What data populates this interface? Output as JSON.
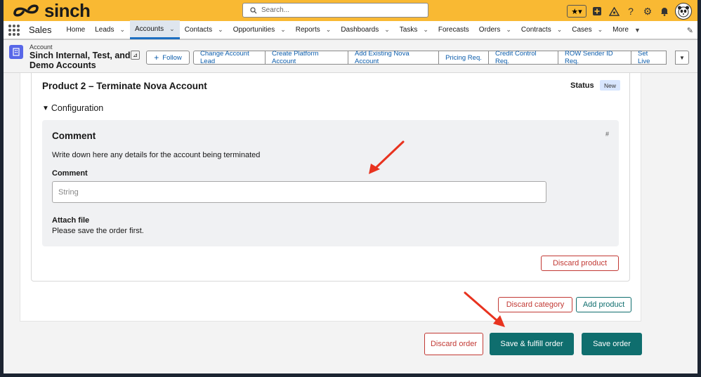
{
  "brand": {
    "name": "sinch"
  },
  "search": {
    "placeholder": "Search..."
  },
  "nav": {
    "app_name": "Sales",
    "items": [
      {
        "label": "Home",
        "has_menu": false,
        "active": false
      },
      {
        "label": "Leads",
        "has_menu": true,
        "active": false
      },
      {
        "label": "Accounts",
        "has_menu": true,
        "active": true
      },
      {
        "label": "Contacts",
        "has_menu": true,
        "active": false
      },
      {
        "label": "Opportunities",
        "has_menu": true,
        "active": false
      },
      {
        "label": "Reports",
        "has_menu": true,
        "active": false
      },
      {
        "label": "Dashboards",
        "has_menu": true,
        "active": false
      },
      {
        "label": "Tasks",
        "has_menu": true,
        "active": false
      },
      {
        "label": "Forecasts",
        "has_menu": false,
        "active": false
      },
      {
        "label": "Orders",
        "has_menu": true,
        "active": false
      },
      {
        "label": "Contracts",
        "has_menu": true,
        "active": false
      },
      {
        "label": "Cases",
        "has_menu": true,
        "active": false
      },
      {
        "label": "More",
        "has_menu": true,
        "active": false
      }
    ]
  },
  "record": {
    "type": "Account",
    "name": "Sinch Internal, Test, and Demo Accounts",
    "follow_label": "Follow",
    "actions": [
      "Change Account Lead",
      "Create Platform Account",
      "Add Existing Nova Account",
      "Pricing Req.",
      "Credit Control Req.",
      "ROW Sender ID Req.",
      "Set Live"
    ]
  },
  "product": {
    "title": "Product 2 – Terminate Nova Account",
    "status_label": "Status",
    "status_value": "New",
    "config_label": "Configuration",
    "comment": {
      "title": "Comment",
      "hash": "#",
      "description": "Write down here any details for the account being terminated",
      "field_label": "Comment",
      "field_placeholder": "String",
      "attach_label": "Attach file",
      "attach_note": "Please save the order first."
    },
    "discard_product": "Discard product"
  },
  "category": {
    "discard": "Discard category",
    "add_product": "Add product"
  },
  "order": {
    "discard": "Discard order",
    "save_fulfill": "Save & fulfill order",
    "save": "Save order"
  },
  "colors": {
    "brand_yellow": "#f9b933",
    "teal": "#0f6e6e",
    "danger": "#c23934",
    "annotation_arrow": "#e8331f"
  }
}
